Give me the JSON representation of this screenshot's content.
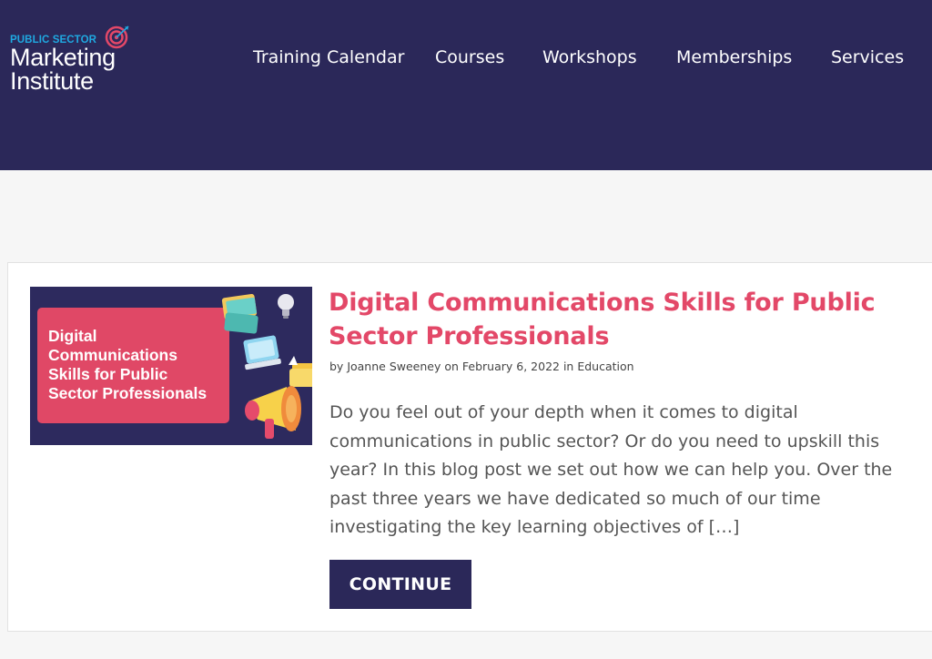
{
  "header": {
    "logo": {
      "line_top": "PUBLIC SECTOR",
      "line_1": "Marketing",
      "line_2": "Institute",
      "icon": "target-arrow-icon"
    },
    "nav": [
      {
        "label": "Training Calendar"
      },
      {
        "label": "Courses"
      },
      {
        "label": "Workshops"
      },
      {
        "label": "Memberships"
      },
      {
        "label": "Services"
      }
    ]
  },
  "post": {
    "thumbnail_text": "Digital\nCommunications\nSkills for Public\nSector Professionals",
    "title": "Digital Communications Skills for Public Sector Professionals",
    "meta": {
      "by": "by ",
      "author": "Joanne Sweeney",
      "on": " on ",
      "date": "February 6, 2022",
      "in": " in ",
      "category": "Education"
    },
    "excerpt": "Do you feel out of your depth when it comes to digital communications in public sector? Or do you need to upskill this year? In this blog post we set out how we can help you. Over the past three years we have dedicated so much of our time investigating the key learning objectives of […]",
    "continue_label": "CONTINUE"
  },
  "colors": {
    "header_bg": "#2b2859",
    "accent_pink": "#e34868",
    "logo_blue": "#1fa9e1",
    "page_bg": "#f6f6f6"
  }
}
